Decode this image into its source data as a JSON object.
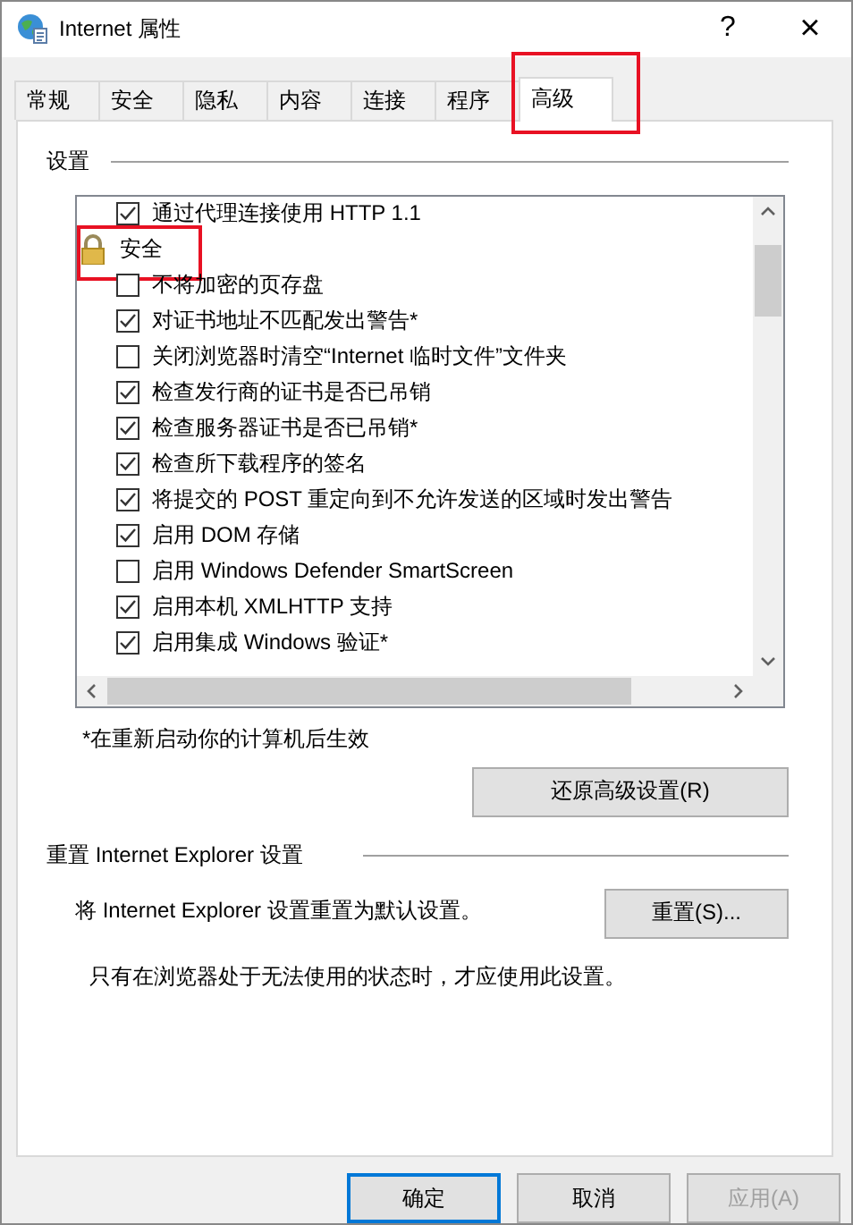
{
  "window": {
    "title": "Internet 属性",
    "help": "?",
    "close": "×"
  },
  "tabs": [
    {
      "label": "常规",
      "selected": false,
      "highlighted": false
    },
    {
      "label": "安全",
      "selected": false,
      "highlighted": false
    },
    {
      "label": "隐私",
      "selected": false,
      "highlighted": false
    },
    {
      "label": "内容",
      "selected": false,
      "highlighted": false
    },
    {
      "label": "连接",
      "selected": false,
      "highlighted": false
    },
    {
      "label": "程序",
      "selected": false,
      "highlighted": false
    },
    {
      "label": "高级",
      "selected": true,
      "highlighted": true
    }
  ],
  "settings": {
    "title": "设置",
    "items": [
      {
        "kind": "checkbox",
        "label": "通过代理连接使用 HTTP 1.1",
        "checked": true
      },
      {
        "kind": "group",
        "label": "安全",
        "highlighted": true
      },
      {
        "kind": "checkbox",
        "label": "不将加密的页存盘",
        "checked": false
      },
      {
        "kind": "checkbox",
        "label": "对证书地址不匹配发出警告*",
        "checked": true
      },
      {
        "kind": "checkbox",
        "label": "关闭浏览器时清空“Internet 临时文件”文件夹",
        "checked": false
      },
      {
        "kind": "checkbox",
        "label": "检查发行商的证书是否已吊销",
        "checked": true
      },
      {
        "kind": "checkbox",
        "label": "检查服务器证书是否已吊销*",
        "checked": true
      },
      {
        "kind": "checkbox",
        "label": "检查所下载程序的签名",
        "checked": true
      },
      {
        "kind": "checkbox",
        "label": "将提交的 POST 重定向到不允许发送的区域时发出警告",
        "checked": true
      },
      {
        "kind": "checkbox",
        "label": "启用 DOM 存储",
        "checked": true
      },
      {
        "kind": "checkbox",
        "label": "启用 Windows Defender SmartScreen",
        "checked": false
      },
      {
        "kind": "checkbox",
        "label": "启用本机 XMLHTTP 支持",
        "checked": true
      },
      {
        "kind": "checkbox",
        "label": "启用集成 Windows 验证*",
        "checked": true
      }
    ],
    "note": "*在重新启动你的计算机后生效",
    "restore_button": "还原高级设置(R)"
  },
  "reset": {
    "title": "重置 Internet Explorer 设置",
    "description": "将 Internet Explorer 设置重置为默认设置。",
    "button": "重置(S)...",
    "note": "只有在浏览器处于无法使用的状态时，才应使用此设置。"
  },
  "buttons": [
    {
      "label": "确定",
      "default": true,
      "disabled": false
    },
    {
      "label": "取消",
      "default": false,
      "disabled": false
    },
    {
      "label": "应用(A)",
      "default": false,
      "disabled": true
    }
  ]
}
